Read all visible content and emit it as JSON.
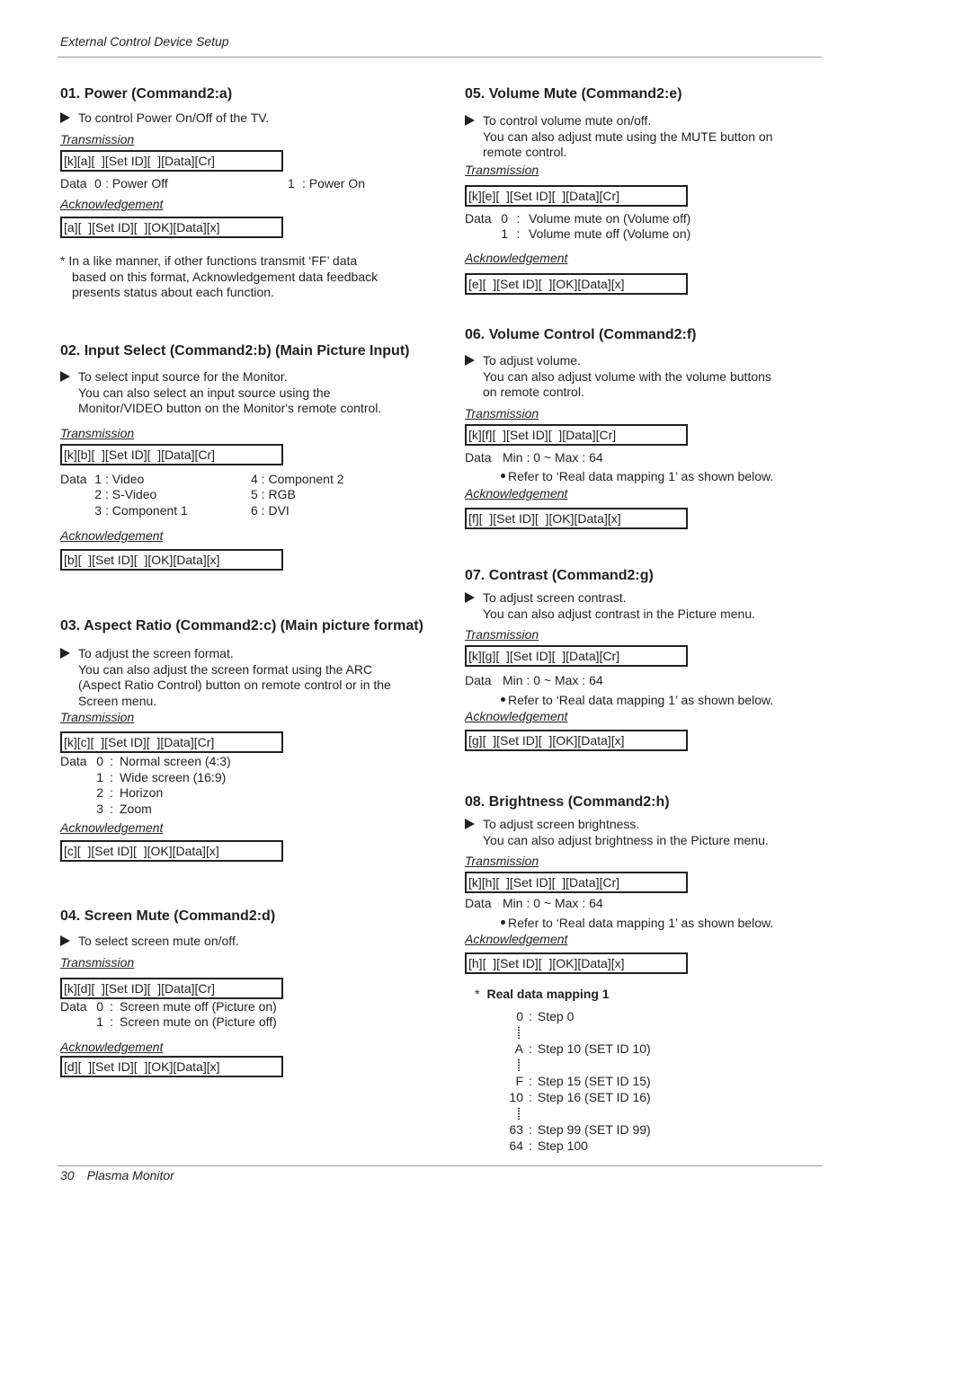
{
  "header": {
    "title": "External Control Device Setup"
  },
  "footer": {
    "page_number": "30",
    "product": "Plasma Monitor"
  },
  "labels": {
    "transmission": "Transmission",
    "acknowledgement": "Acknowledgement",
    "data": "Data"
  },
  "sections": [
    {
      "title": "01. Power (Command2:a)",
      "desc": [
        "To control Power On/Off of the TV."
      ],
      "transmission": "[k][a][  ][Set ID][  ][Data][Cr]",
      "data_rows": [
        [
          "Data",
          "0",
          ": Power Off",
          "1",
          ": Power On"
        ]
      ],
      "acknowledgement": "[a][  ][Set ID][  ][OK][Data][x]",
      "note": [
        "* In a like manner, if other functions transmit ‘FF’ data",
        "based on this format, Acknowledgement data feedback",
        "presents status about each function."
      ]
    },
    {
      "title": "02. Input Select (Command2:b) (Main Picture Input)",
      "desc": [
        "To select input source for the Monitor.",
        "You can also select an input source using the",
        "Monitor/VIDEO button on the Monitor's remote control."
      ],
      "transmission": "[k][b][  ][Set ID][  ][Data][Cr]",
      "data_rows": [
        [
          "Data",
          "1",
          ": Video",
          "4 : Component 2"
        ],
        [
          "",
          "2",
          ": S-Video",
          "5 : RGB"
        ],
        [
          "",
          "3",
          ": Component 1",
          "6 : DVI"
        ]
      ],
      "acknowledgement": "[b][  ][Set ID][  ][OK][Data][x]"
    },
    {
      "title": "03. Aspect Ratio (Command2:c) (Main picture format)",
      "desc": [
        "To adjust the screen format.",
        "You can also adjust the screen format using the ARC",
        "(Aspect Ratio Control) button on remote control or in the",
        "Screen menu."
      ],
      "transmission": "[k][c][  ][Set ID][  ][Data][Cr]",
      "data_rows": [
        [
          "Data",
          "0",
          ":",
          "Normal screen (4:3)"
        ],
        [
          "",
          "1",
          ":",
          "Wide screen (16:9)"
        ],
        [
          "",
          "2",
          ":",
          "Horizon"
        ],
        [
          "",
          "3",
          ":",
          "Zoom"
        ]
      ],
      "acknowledgement": "[c][  ][Set ID][  ][OK][Data][x]"
    },
    {
      "title": "04. Screen Mute (Command2:d)",
      "desc": [
        "To select screen mute on/off."
      ],
      "transmission": "[k][d][  ][Set ID][  ][Data][Cr]",
      "data_rows": [
        [
          "Data",
          "0",
          ":",
          "Screen mute off (Picture on)"
        ],
        [
          "",
          "1",
          ":",
          "Screen mute on (Picture off)"
        ]
      ],
      "acknowledgement": "[d][  ][Set ID][  ][OK][Data][x]"
    },
    {
      "title": "05. Volume Mute (Command2:e)",
      "desc": [
        "To control volume mute on/off.",
        "You can also adjust mute using the MUTE button on",
        "remote control."
      ],
      "transmission": "[k][e][  ][Set ID][  ][Data][Cr]",
      "data_rows": [
        [
          "Data",
          "0",
          ":",
          "Volume mute on (Volume off)"
        ],
        [
          "",
          "1",
          ":",
          "Volume mute off (Volume on)"
        ]
      ],
      "acknowledgement": "[e][  ][Set ID][  ][OK][Data][x]"
    },
    {
      "title": "06. Volume Control (Command2:f)",
      "desc": [
        "To adjust volume.",
        "You can also adjust volume with the volume buttons",
        "on remote control."
      ],
      "transmission": "[k][f][  ][Set ID][  ][Data][Cr]",
      "data_rows": [
        [
          "Data",
          "Min : 0 ~ Max : 64"
        ]
      ],
      "bullet": "Refer to ‘Real data mapping 1’ as shown below.",
      "acknowledgement": "[f][  ][Set ID][  ][OK][Data][x]"
    },
    {
      "title": "07. Contrast (Command2:g)",
      "desc": [
        "To adjust screen contrast.",
        "You can also adjust contrast in the Picture menu."
      ],
      "transmission": "[k][g][  ][Set ID][  ][Data][Cr]",
      "data_rows": [
        [
          "Data",
          "Min : 0 ~ Max : 64"
        ]
      ],
      "bullet": "Refer to ‘Real data mapping 1’ as shown below.",
      "acknowledgement": "[g][  ][Set ID][  ][OK][Data][x]"
    },
    {
      "title": "08. Brightness (Command2:h)",
      "desc": [
        "To adjust screen brightness.",
        "You can also adjust brightness in the Picture menu."
      ],
      "transmission": "[k][h][  ][Set ID][  ][Data][Cr]",
      "data_rows": [
        [
          "Data",
          "Min : 0 ~ Max : 64"
        ]
      ],
      "bullet": "Refer to ‘Real data mapping 1’ as shown below.",
      "acknowledgement": "[h][  ][Set ID][  ][OK][Data][x]"
    }
  ],
  "mapping": {
    "star": "*",
    "title": "Real data mapping 1",
    "rows": [
      {
        "key": "0",
        "sep": ":",
        "value": "Step 0"
      },
      {
        "ellipsis": true
      },
      {
        "key": "A",
        "sep": ":",
        "value": "Step 10 (SET ID 10)"
      },
      {
        "ellipsis": true
      },
      {
        "key": "F",
        "sep": ":",
        "value": "Step 15 (SET ID 15)"
      },
      {
        "key": "10",
        "sep": ":",
        "value": "Step 16 (SET ID 16)"
      },
      {
        "ellipsis": true
      },
      {
        "key": "63",
        "sep": ":",
        "value": "Step 99 (SET ID 99)"
      },
      {
        "key": "64",
        "sep": ":",
        "value": "Step 100"
      }
    ]
  }
}
